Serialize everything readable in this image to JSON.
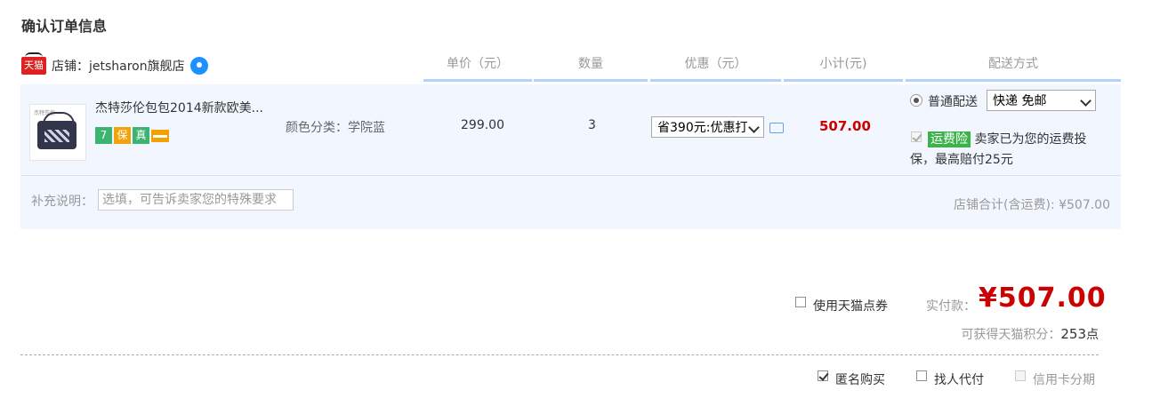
{
  "page_title": "确认订单信息",
  "shop": {
    "badge": "天猫",
    "label": "店铺：jetsharon旗舰店"
  },
  "columns": [
    "单价（元）",
    "数量",
    "优惠（元）",
    "小计(元)",
    "配送方式"
  ],
  "item": {
    "name": "杰特莎伦包包2014新款欧美...",
    "thumb_text": "杰特莎伦",
    "badges": [
      "7",
      "保",
      "真"
    ],
    "sku": "颜色分类：学院蓝",
    "unit_price": "299.00",
    "quantity": "3",
    "discount_select": "省390元:优惠打",
    "subtotal": "507.00",
    "shipping_option_label": "普通配送",
    "shipping_select": "快递 免邮",
    "insurance_tag": "运费险",
    "insurance_text_1": "卖家已为您的运费投",
    "insurance_text_2": "保，最高赔付25元"
  },
  "note": {
    "label": "补充说明：",
    "placeholder": "选填，可告诉卖家您的特殊要求"
  },
  "shop_total": "店铺合计(含运费): ¥507.00",
  "coupon_label": "使用天猫点券",
  "actual_pay_label": "实付款：",
  "actual_pay_value": "¥507.00",
  "points_label": "可获得天猫积分：",
  "points_value": "253",
  "points_unit": "点",
  "options": {
    "anonymous": "匿名购买",
    "proxy": "找人代付",
    "installment": "信用卡分期"
  },
  "colors": {
    "accent_red": "#cc0000",
    "row_bg": "#f2f7ff",
    "header_line": "#b2d1ff",
    "tag_green": "#3bb34a"
  }
}
